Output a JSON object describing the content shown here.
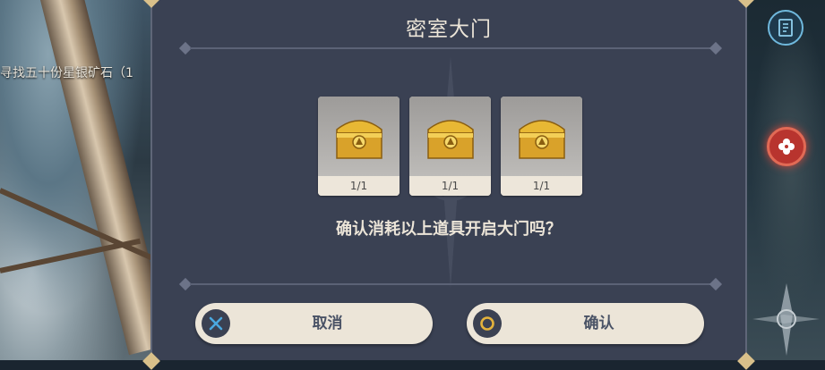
{
  "background": {
    "quest_text": "寻找五十份星银矿石（1"
  },
  "side_buttons": {
    "quest_icon": "quest-book-icon",
    "alert_icon": "four-leaf-alert-icon"
  },
  "dialog": {
    "title": "密室大门",
    "items": [
      {
        "icon": "golden-chest-icon",
        "count": "1/1"
      },
      {
        "icon": "golden-chest-icon",
        "count": "1/1"
      },
      {
        "icon": "golden-chest-icon",
        "count": "1/1"
      }
    ],
    "question": "确认消耗以上道具开启大门吗？",
    "cancel_label": "取消",
    "confirm_label": "确认"
  },
  "colors": {
    "dialog_bg": "#3a4153",
    "button_bg": "#ece5d8",
    "cancel_icon": "#4aa8e0",
    "confirm_icon": "#e3b23c",
    "text_light": "#ece5d8"
  }
}
